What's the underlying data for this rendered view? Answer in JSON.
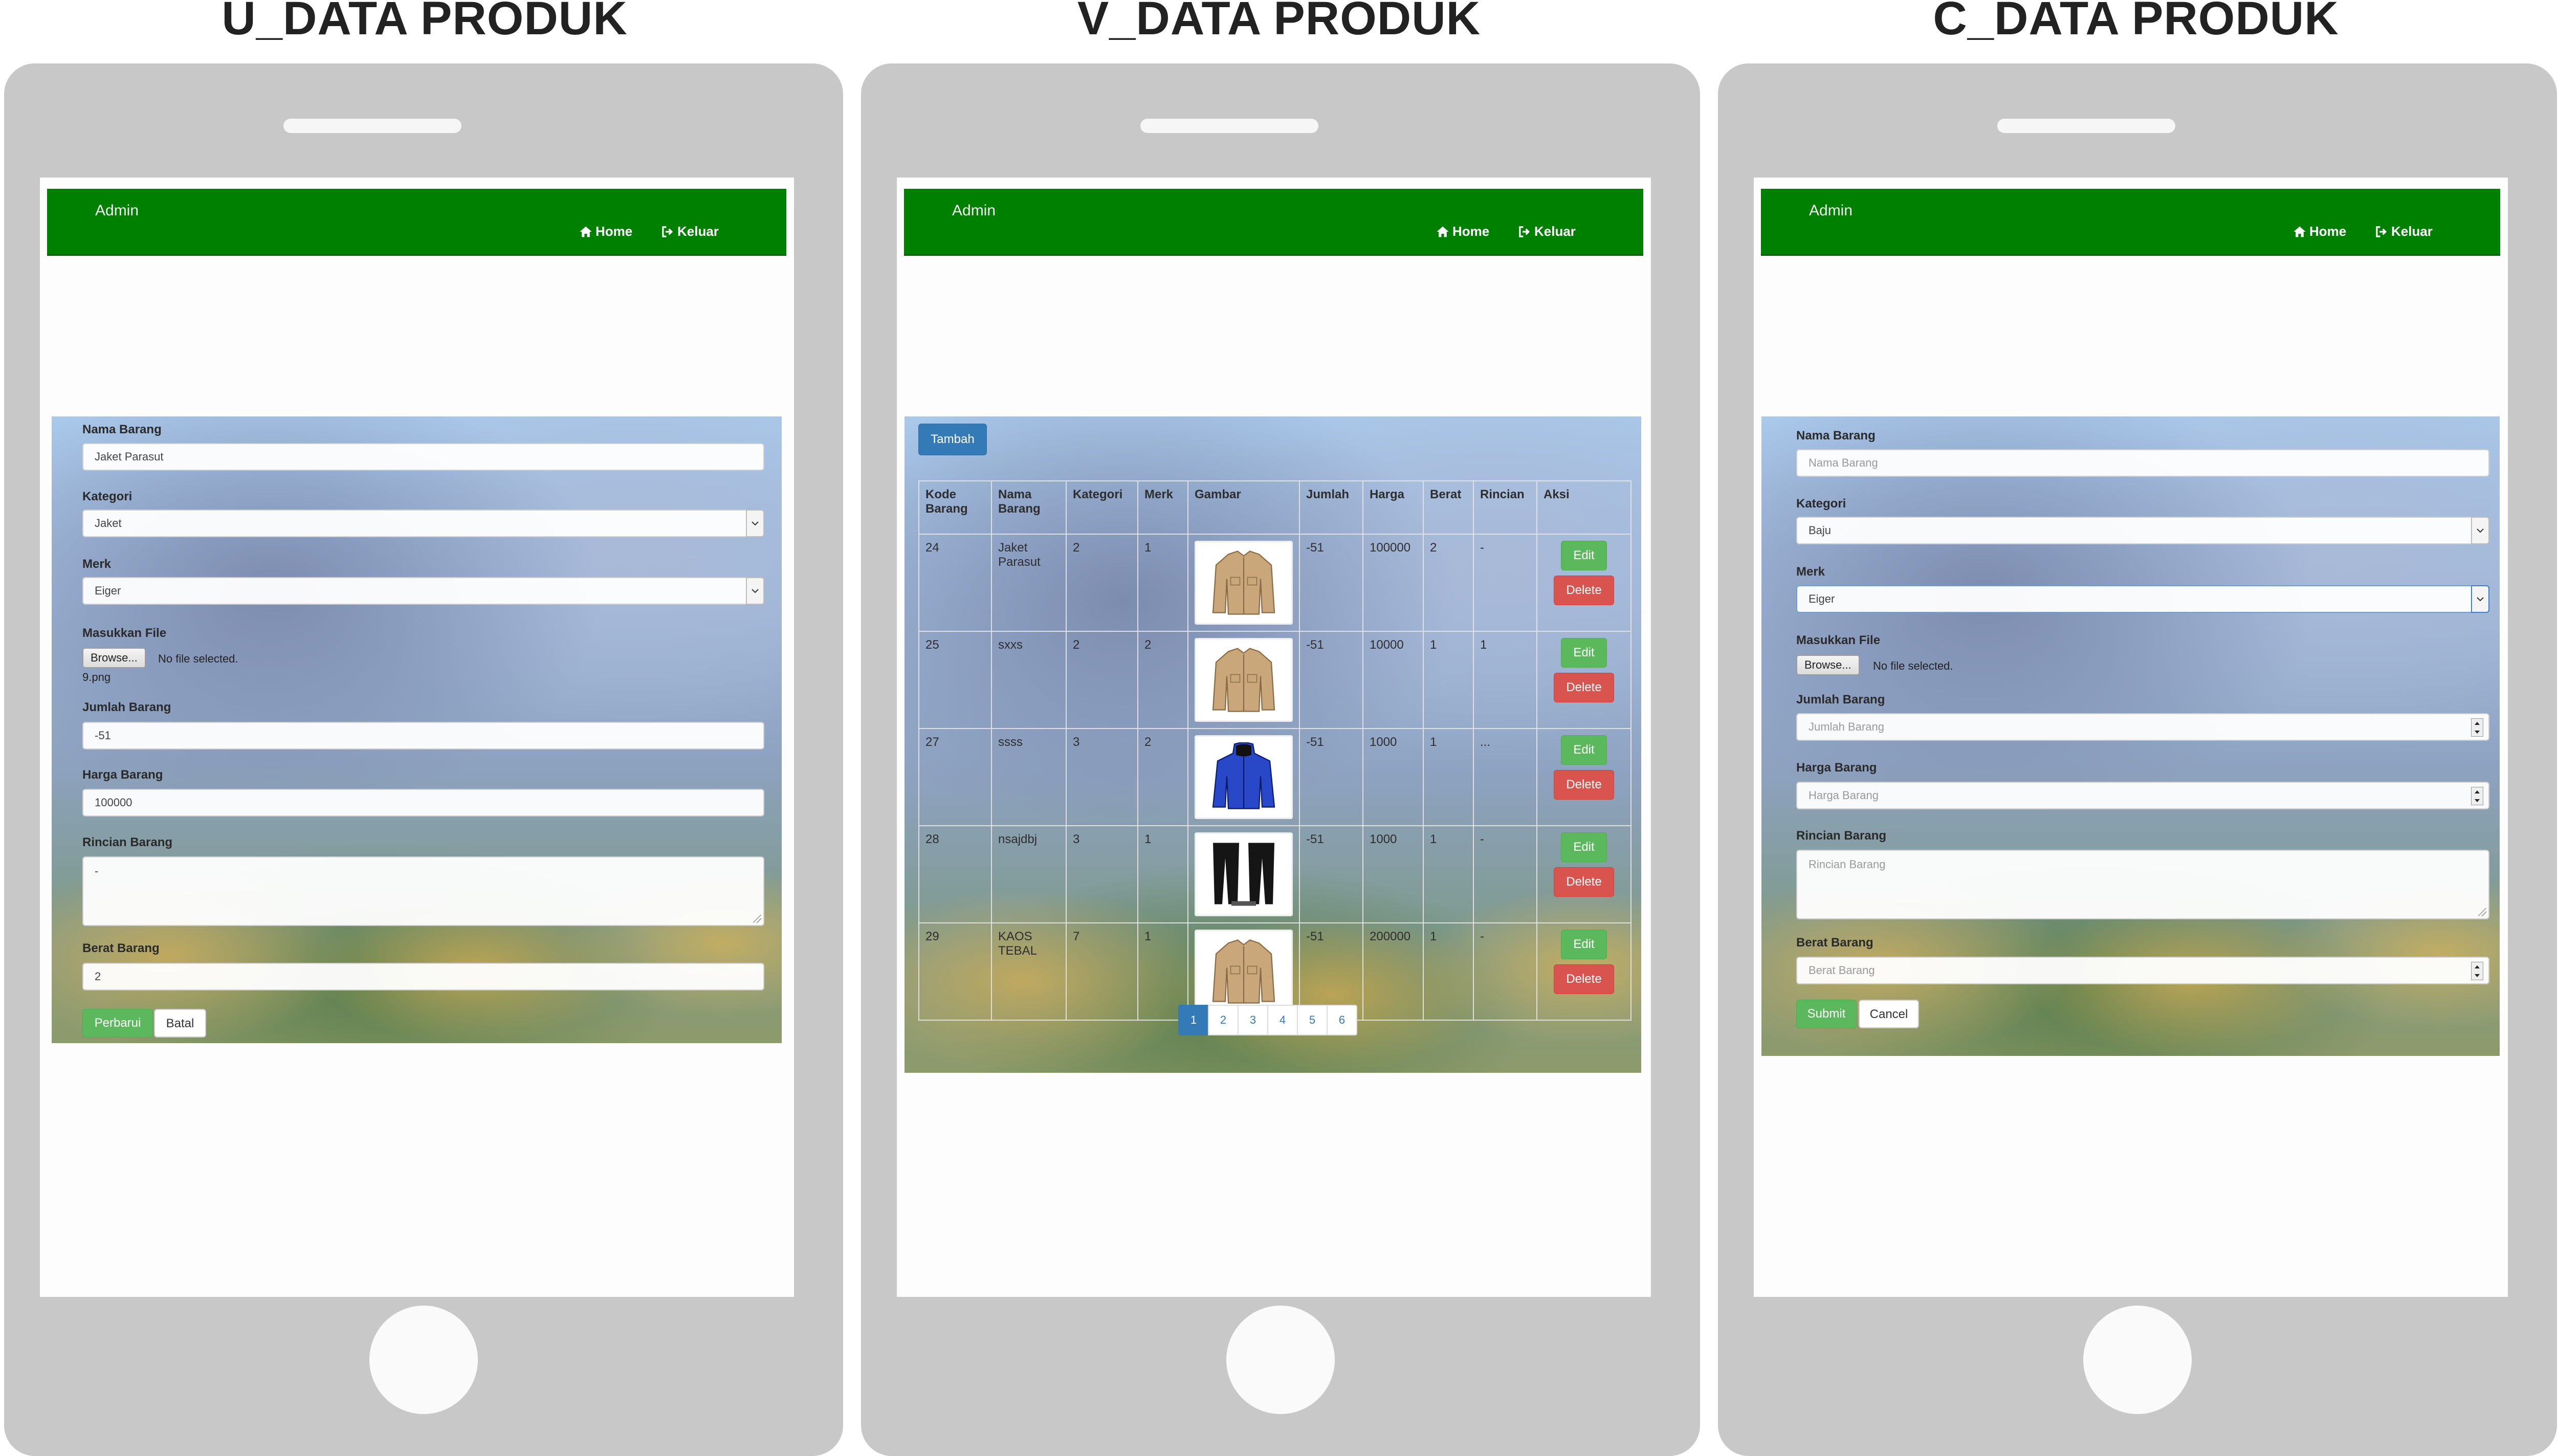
{
  "titles": {
    "left": "U_DATA PRODUK",
    "middle": "V_DATA PRODUK",
    "right": "C_DATA PRODUK"
  },
  "nav": {
    "brand": "Admin",
    "home": "Home",
    "keluar": "Keluar"
  },
  "update_form": {
    "nama_label": "Nama Barang",
    "nama_value": "Jaket Parasut",
    "kategori_label": "Kategori",
    "kategori_value": "Jaket",
    "merk_label": "Merk",
    "merk_value": "Eiger",
    "file_label": "Masukkan File",
    "browse": "Browse...",
    "no_file": "No file selected.",
    "current_file": "9.png",
    "jumlah_label": "Jumlah Barang",
    "jumlah_value": "-51",
    "harga_label": "Harga Barang",
    "harga_value": "100000",
    "rincian_label": "Rincian Barang",
    "rincian_value": "-",
    "berat_label": "Berat Barang",
    "berat_value": "2",
    "submit": "Perbarui",
    "cancel": "Batal"
  },
  "table_view": {
    "add_button": "Tambah",
    "headers": [
      "Kode Barang",
      "Nama Barang",
      "Kategori",
      "Merk",
      "Gambar",
      "Jumlah",
      "Harga",
      "Berat",
      "Rincian",
      "Aksi"
    ],
    "rows": [
      {
        "kode": "24",
        "nama": "Jaket Parasut",
        "kategori": "2",
        "merk": "1",
        "image": "tan-jacket",
        "jumlah": "-51",
        "harga": "100000",
        "berat": "2",
        "rincian": "-"
      },
      {
        "kode": "25",
        "nama": "sxxs",
        "kategori": "2",
        "merk": "2",
        "image": "tan-jacket",
        "jumlah": "-51",
        "harga": "10000",
        "berat": "1",
        "rincian": "1"
      },
      {
        "kode": "27",
        "nama": "ssss",
        "kategori": "3",
        "merk": "2",
        "image": "blue-jacket",
        "jumlah": "-51",
        "harga": "1000",
        "berat": "1",
        "rincian": "..."
      },
      {
        "kode": "28",
        "nama": "nsajdbj",
        "kategori": "3",
        "merk": "1",
        "image": "black-pants",
        "jumlah": "-51",
        "harga": "1000",
        "berat": "1",
        "rincian": "-"
      },
      {
        "kode": "29",
        "nama": "KAOS TEBAL",
        "kategori": "7",
        "merk": "1",
        "image": "tan-jacket",
        "jumlah": "-51",
        "harga": "200000",
        "berat": "1",
        "rincian": "-"
      }
    ],
    "edit": "Edit",
    "delete": "Delete",
    "pages": [
      "1",
      "2",
      "3",
      "4",
      "5",
      "6"
    ],
    "active_page": "1"
  },
  "create_form": {
    "nama_label": "Nama Barang",
    "nama_placeholder": "Nama Barang",
    "kategori_label": "Kategori",
    "kategori_value": "Baju",
    "merk_label": "Merk",
    "merk_value": "Eiger",
    "file_label": "Masukkan File",
    "browse": "Browse...",
    "no_file": "No file selected.",
    "jumlah_label": "Jumlah Barang",
    "jumlah_placeholder": "Jumlah Barang",
    "harga_label": "Harga Barang",
    "harga_placeholder": "Harga Barang",
    "rincian_label": "Rincian Barang",
    "rincian_placeholder": "Rincian Barang",
    "berat_label": "Berat Barang",
    "berat_placeholder": "Berat Barang",
    "submit": "Submit",
    "cancel": "Cancel"
  },
  "colors": {
    "navbar": "#008000",
    "edit": "#5cb85c",
    "delete": "#d9534f",
    "primary": "#337ab7",
    "phone": "#c8c8c8"
  }
}
